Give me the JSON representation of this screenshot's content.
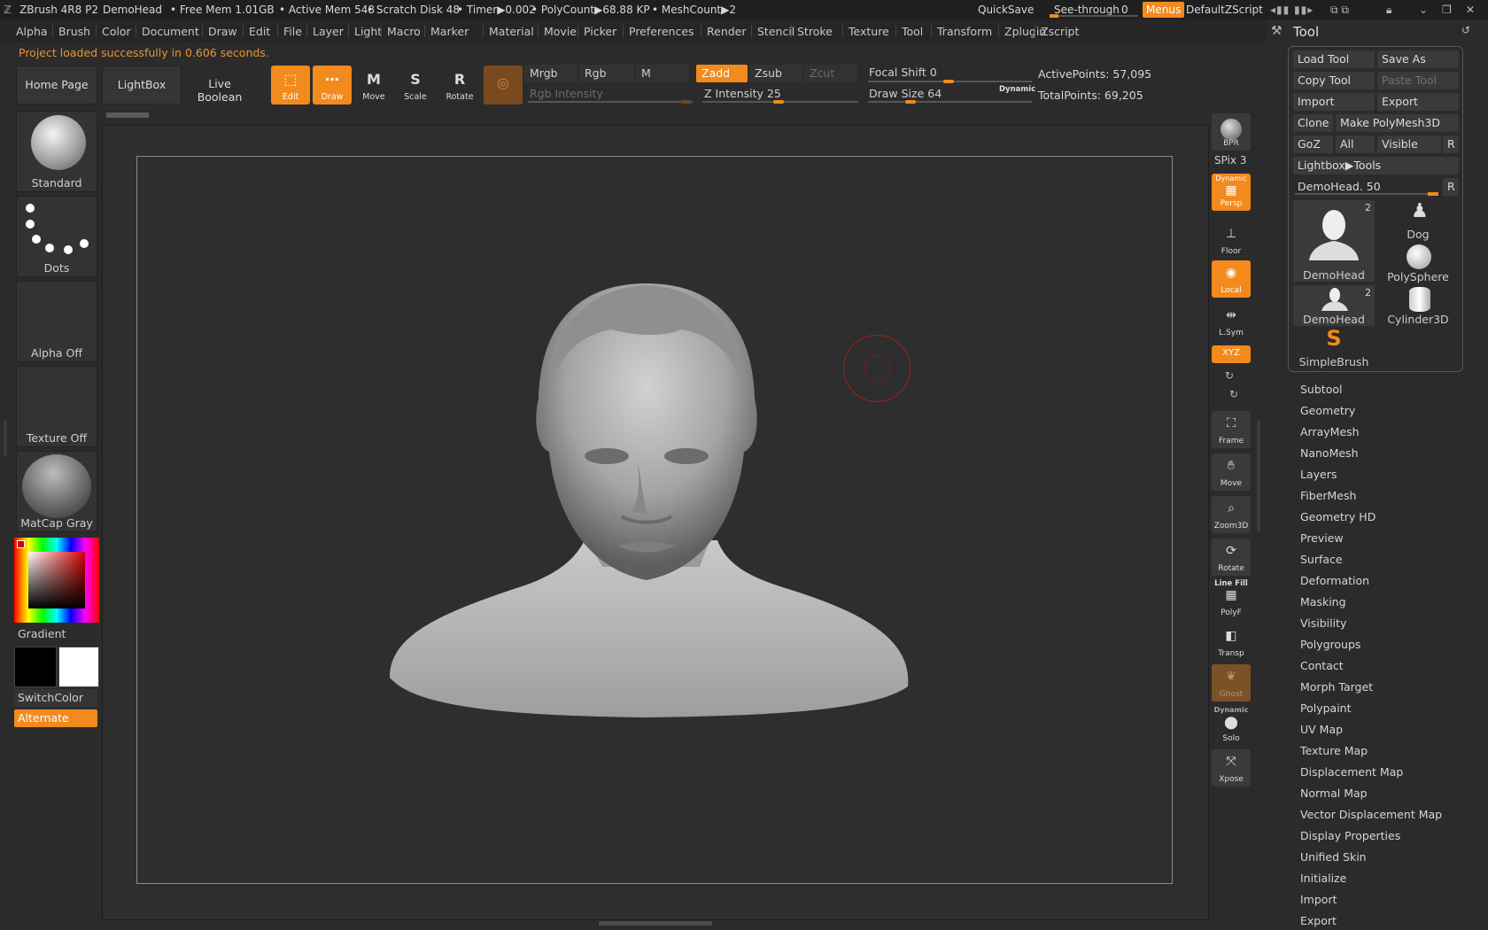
{
  "title_bar": {
    "app": "ZBrush 4R8 P2",
    "document": "DemoHead",
    "free_mem": "• Free Mem 1.01GB",
    "active_mem": "• Active Mem 548",
    "scratch": "• Scratch Disk 48",
    "timer": "• Timer▶0.002",
    "polycount": "• PolyCount▶68.88 KP",
    "meshcount": "• MeshCount▶2",
    "quicksave": "QuickSave",
    "see_through": "See-through",
    "see_through_value": "0",
    "menus": "Menus",
    "zscript": "DefaultZScript"
  },
  "menus": [
    "Alpha",
    "Brush",
    "Color",
    "Document",
    "Draw",
    "Edit",
    "File",
    "Layer",
    "Light",
    "Macro",
    "Marker",
    "Material",
    "Movie",
    "Picker",
    "Preferences",
    "Render",
    "Stencil",
    "Stroke",
    "Texture",
    "Tool",
    "Transform",
    "Zplugin",
    "Zscript"
  ],
  "status": "Project loaded successfully in 0.606 seconds.",
  "shelf": {
    "home_page": "Home Page",
    "lightbox": "LightBox",
    "live_boolean": "Live Boolean",
    "edit": "Edit",
    "draw": "Draw",
    "move": "Move",
    "scale": "Scale",
    "rotate": "Rotate",
    "mrgb": "Mrgb",
    "rgb": "Rgb",
    "m": "M",
    "zadd": "Zadd",
    "zsub": "Zsub",
    "zcut": "Zcut",
    "rgb_intensity": "Rgb Intensity",
    "z_intensity_label": "Z Intensity",
    "z_intensity": "25",
    "focal_shift_label": "Focal Shift",
    "focal_shift": "0",
    "draw_size_label": "Draw Size",
    "draw_size": "64",
    "dynamic": "Dynamic",
    "active_points": "ActivePoints: 57,095",
    "total_points": "TotalPoints: 69,205"
  },
  "left": {
    "brush": "Standard",
    "stroke": "Dots",
    "alpha": "Alpha Off",
    "texture": "Texture Off",
    "material": "MatCap Gray",
    "gradient": "Gradient",
    "switch_color": "SwitchColor",
    "alternate": "Alternate"
  },
  "right": {
    "bpr": "BPR",
    "spix_label": "SPix",
    "spix": "3",
    "dynamic": "Dynamic",
    "persp": "Persp",
    "floor": "Floor",
    "local": "Local",
    "lsym": "L.Sym",
    "xyz": "XYZ",
    "frame": "Frame",
    "move": "Move",
    "zoom3d": "Zoom3D",
    "rotate": "Rotate",
    "line_fill": "Line Fill",
    "polyf": "PolyF",
    "transp": "Transp",
    "ghost": "Ghost",
    "dynamic2": "Dynamic",
    "solo": "Solo",
    "xpose": "Xpose"
  },
  "tool_palette": {
    "title": "Tool",
    "load_tool": "Load Tool",
    "save_as": "Save As",
    "copy_tool": "Copy Tool",
    "paste_tool": "Paste Tool",
    "import": "Import",
    "export": "Export",
    "clone": "Clone",
    "make_polymesh": "Make PolyMesh3D",
    "goz": "GoZ",
    "all": "All",
    "visible": "Visible",
    "r": "R",
    "lightbox_tools": "Lightbox▶Tools",
    "current_tool": "DemoHead.",
    "current_tool_value": "50",
    "thumbs": [
      {
        "name": "DemoHead",
        "count": "2"
      },
      {
        "name": "Dog",
        "count": ""
      },
      {
        "name": "PolySphere",
        "count": ""
      },
      {
        "name": "DemoHead",
        "count": "2"
      },
      {
        "name": "Cylinder3D",
        "count": ""
      },
      {
        "name": "SimpleBrush",
        "count": ""
      }
    ],
    "subpalettes": [
      "Subtool",
      "Geometry",
      "ArrayMesh",
      "NanoMesh",
      "Layers",
      "FiberMesh",
      "Geometry HD",
      "Preview",
      "Surface",
      "Deformation",
      "Masking",
      "Visibility",
      "Polygroups",
      "Contact",
      "Morph Target",
      "Polypaint",
      "UV Map",
      "Texture Map",
      "Displacement Map",
      "Normal Map",
      "Vector Displacement Map",
      "Display Properties",
      "Unified Skin",
      "Initialize",
      "Import",
      "Export"
    ]
  },
  "colors": {
    "accent": "#f28a1e",
    "background": "#2b2b2b",
    "panel": "#333333"
  }
}
